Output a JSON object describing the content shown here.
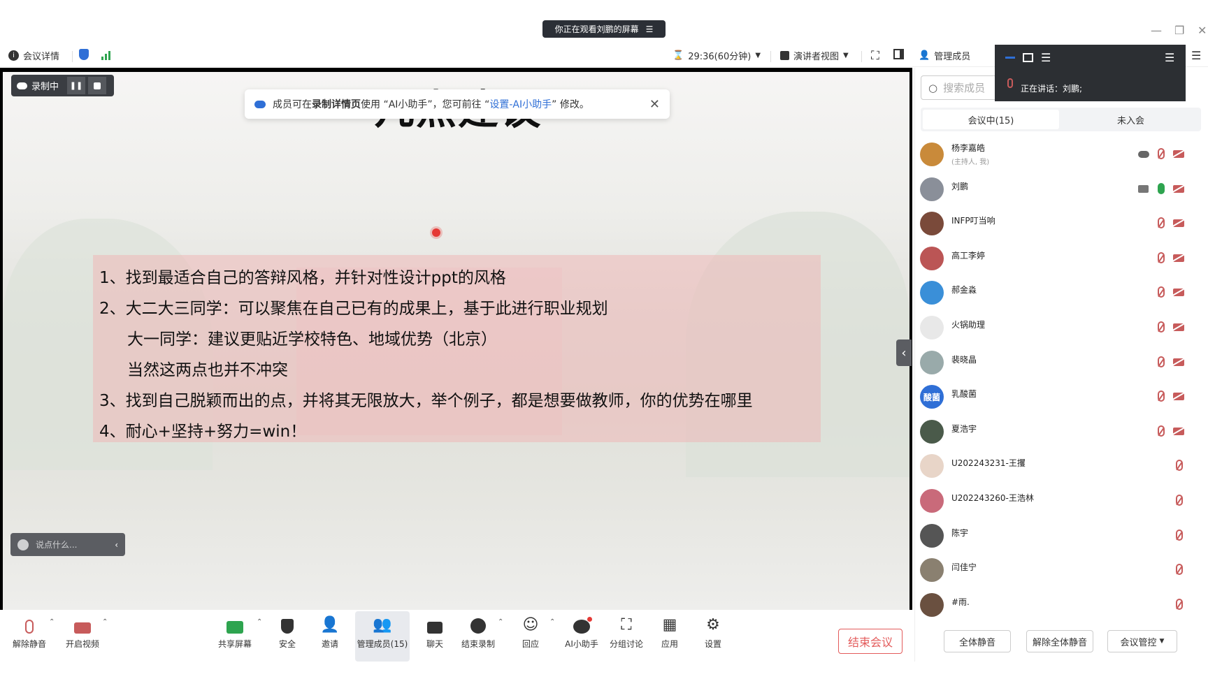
{
  "share_banner": "你正在观看刘鹏的屏幕",
  "toolbar": {
    "meeting_details": "会议详情",
    "timer": "29:36(60分钟)",
    "presenter_view": "演讲者视图",
    "manage_members": "管理成员"
  },
  "recording": {
    "label": "录制中"
  },
  "notice": {
    "part1": "成员可在",
    "bold": "录制详情页",
    "part2": "使用 “AI小助手”，您可前往 “",
    "link": "设置-AI小助手",
    "part3": "” 修改。"
  },
  "slide": {
    "title": "几点建议",
    "points": [
      "1、找到最适合自己的答辩风格，并针对性设计ppt的风格",
      "2、大二大三同学：可以聚焦在自己已有的成果上，基于此进行职业规划",
      "大一同学：建议更贴近学校特色、地域优势（北京）",
      "当然这两点也并不冲突",
      "3、找到自己脱颖而出的点，并将其无限放大，举个例子，都是想要做教师，你的优势在哪里",
      "4、耐心+坚持+努力=win！"
    ]
  },
  "chat_placeholder": "说点什么...",
  "bottom": {
    "unmute": "解除静音",
    "start_video": "开启视频",
    "share_screen": "共享屏幕",
    "security": "安全",
    "invite": "邀请",
    "manage_members": "管理成员(15)",
    "chat": "聊天",
    "end_recording": "结束录制",
    "react": "回应",
    "ai_assistant": "AI小助手",
    "breakout": "分组讨论",
    "apps": "应用",
    "settings": "设置",
    "end_meeting": "结束会议"
  },
  "panel": {
    "search_placeholder": "搜索成员",
    "speaking": "正在讲话：刘鹏;",
    "tab_in_meeting": "会议中(15)",
    "tab_not_joined": "未入会",
    "members": [
      {
        "name": "杨李嘉皓",
        "sub": "(主持人, 我)",
        "color": "#c98a3a",
        "initial": ""
      },
      {
        "name": "刘鹏",
        "sub": "",
        "color": "#8a8f99",
        "initial": ""
      },
      {
        "name": "INFP叮当响",
        "sub": "",
        "color": "#7a4a3a",
        "initial": ""
      },
      {
        "name": "高工李婷",
        "sub": "",
        "color": "#b55",
        "initial": ""
      },
      {
        "name": "郝金淼",
        "sub": "",
        "color": "#3a8fd8",
        "initial": ""
      },
      {
        "name": "火锅助理",
        "sub": "",
        "color": "#e8e8e8",
        "initial": ""
      },
      {
        "name": "裴晓晶",
        "sub": "",
        "color": "#9aa",
        "initial": ""
      },
      {
        "name": "乳酸菌",
        "sub": "",
        "color": "#2f6fd6",
        "initial": "酸菌"
      },
      {
        "name": "夏浩宇",
        "sub": "",
        "color": "#4a5a4a",
        "initial": ""
      },
      {
        "name": "U202243231-王攫",
        "sub": "",
        "color": "#e8d5c8",
        "initial": ""
      },
      {
        "name": "U202243260-王浩林",
        "sub": "",
        "color": "#c96a7a",
        "initial": ""
      },
      {
        "name": "陈宇",
        "sub": "",
        "color": "#555",
        "initial": ""
      },
      {
        "name": "闫佳宁",
        "sub": "",
        "color": "#8a8070",
        "initial": ""
      },
      {
        "name": "#雨.",
        "sub": "",
        "color": "#6a5040",
        "initial": ""
      }
    ],
    "mute_all": "全体静音",
    "unmute_all": "解除全体静音",
    "meeting_control": "会议管控"
  }
}
